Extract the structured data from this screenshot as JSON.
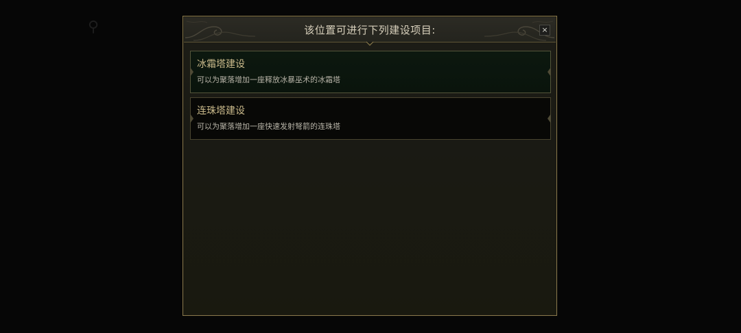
{
  "dialog": {
    "title": "该位置可进行下列建设项目:",
    "close_label": "×"
  },
  "items": [
    {
      "title": "冰霜塔建设",
      "description": "可以为聚落增加一座释放冰暴巫术的冰霜塔",
      "state": "selected"
    },
    {
      "title": "连珠塔建设",
      "description": "可以为聚落增加一座快速发射弩箭的连珠塔",
      "state": "normal"
    }
  ],
  "colors": {
    "frame_border": "#8a7a4c",
    "title_text": "#d8d0bc",
    "item_title": "#c9b98a",
    "item_desc": "#b8b4a8",
    "selected_bg": "#0c180f"
  },
  "icons": {
    "close": "close-icon",
    "header_ornament": "scroll-ornament-icon",
    "header_pointer": "pointer-caret-icon"
  }
}
